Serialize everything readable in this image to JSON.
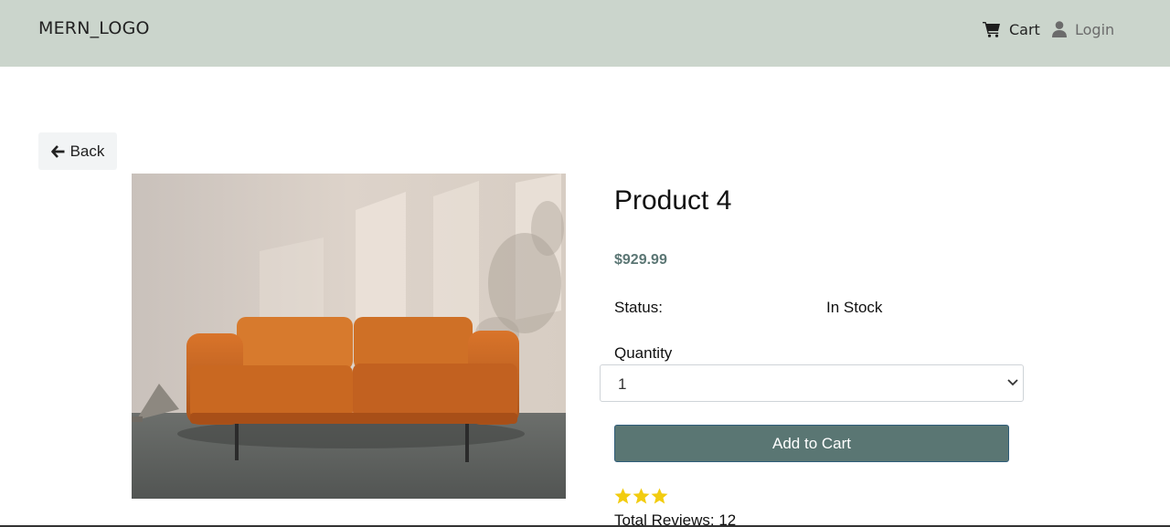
{
  "navbar": {
    "logo": "MERN_LOGO",
    "cart_label": "Cart",
    "login_label": "Login"
  },
  "back_button": {
    "label": "Back"
  },
  "product": {
    "title": "Product 4",
    "price": "$929.99",
    "status_label": "Status:",
    "status_value": "In Stock",
    "quantity_label": "Quantity",
    "quantity_selected": "1",
    "add_to_cart_label": "Add to Cart",
    "rating_stars": 3,
    "total_reviews": "Total Reviews: 12",
    "image_subject": "orange leather sofa"
  },
  "colors": {
    "navbar_bg": "#cbd5cc",
    "accent": "#5a7673",
    "star": "#f2cc0f"
  }
}
